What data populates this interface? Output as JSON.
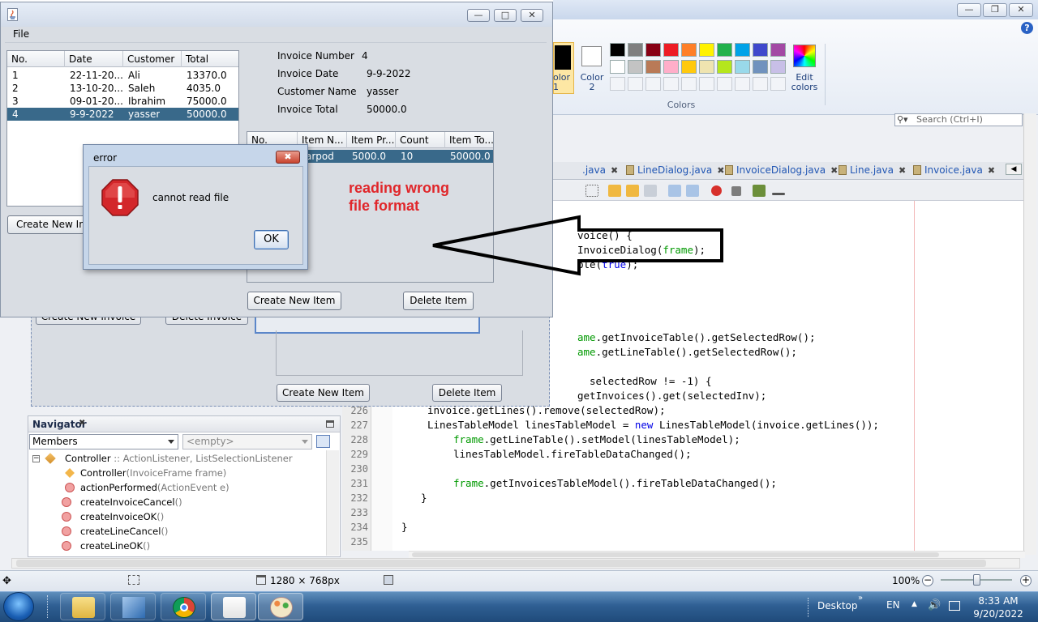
{
  "app": {
    "file_menu": "File",
    "invoices": {
      "columns": [
        "No.",
        "Date",
        "Customer",
        "Total"
      ],
      "rows": [
        {
          "no": "1",
          "date": "22-11-20...",
          "customer": "Ali",
          "total": "13370.0"
        },
        {
          "no": "2",
          "date": "13-10-20...",
          "customer": "Saleh",
          "total": "4035.0"
        },
        {
          "no": "3",
          "date": "09-01-20...",
          "customer": "Ibrahim",
          "total": "75000.0"
        },
        {
          "no": "4",
          "date": "9-9-2022",
          "customer": "yasser",
          "total": "50000.0"
        }
      ],
      "selected_row": "4"
    },
    "details": {
      "invoice_number_label": "Invoice Number",
      "invoice_number": "4",
      "invoice_date_label": "Invoice Date",
      "invoice_date": "9-9-2022",
      "customer_name_label": "Customer Name",
      "customer_name": "yasser",
      "invoice_total_label": "Invoice Total",
      "invoice_total": "50000.0"
    },
    "lines": {
      "columns": [
        "No.",
        "Item N...",
        "Item Pr...",
        "Count",
        "Item To..."
      ],
      "rows": [
        {
          "no": "1",
          "item": "Earpod",
          "price": "5000.0",
          "count": "10",
          "total": "50000.0"
        }
      ],
      "visible_item_fragment": "arpod"
    },
    "buttons": {
      "create_invoice": "Create New Invoice",
      "create_invoice_visible": "Create New Inv",
      "create_item": "Create New Item",
      "delete_item": "Delete Item"
    },
    "annotation_line1": "reading wrong",
    "annotation_line2": "file format"
  },
  "error_dialog": {
    "title": "error",
    "message": "cannot read file",
    "ok_label": "OK"
  },
  "paint": {
    "color1_label": "olor\n1",
    "color2_label": "Color\n2",
    "edit_colors_label": "Edit\ncolors",
    "colors_group_label": "Colors",
    "palette": [
      "#000000",
      "#7f7f7f",
      "#880015",
      "#ed1c24",
      "#ff7f27",
      "#fff200",
      "#22b14c",
      "#00a2e8",
      "#3f48cc",
      "#a349a4",
      "#ffffff",
      "#c3c3c3",
      "#b97a57",
      "#ffaec9",
      "#ffc90e",
      "#efe4b0",
      "#b5e61d",
      "#99d9ea",
      "#7092be",
      "#c8bfe7"
    ],
    "status_size": "1280 × 768px",
    "zoom": "100%"
  },
  "ide": {
    "search_placeholder": "Search (Ctrl+I)",
    "tabs": [
      ".java",
      "LineDialog.java",
      "InvoiceDialog.java",
      "Line.java",
      "Invoice.java"
    ],
    "code": {
      "frag_1": "voice() {",
      "frag_2a": "InvoiceDialog(",
      "frag_2b": "frame",
      "frag_2c": ");",
      "frag_3a": "ble(",
      "frag_3b": "true",
      "frag_3c": ");",
      "frag_4a": "ame",
      "frag_4b": ".getInvoiceTable().getSelectedRow();",
      "frag_5a": "ame",
      "frag_5b": ".getLineTable().getSelectedRow();",
      "frag_6": "selectedRow != -1) {",
      "frag_7": "getInvoices().get(selectedInv);",
      "line_226": "invoice.getLines().remove(selectedRow);",
      "line_227a": "LinesTableModel linesTableModel = ",
      "line_227b": "new",
      "line_227c": " LinesTableModel(invoice.getLines());",
      "line_228a": "frame",
      "line_228b": ".getLineTable().setModel(linesTableModel);",
      "line_229": "linesTableModel.fireTableDataChanged();",
      "line_231a": "frame",
      "line_231b": ".getInvoicesTableModel().fireTableDataChanged();",
      "line_232": "}",
      "line_234": "}"
    },
    "line_numbers": [
      "226",
      "227",
      "228",
      "229",
      "230",
      "231",
      "232",
      "233",
      "234",
      "235"
    ],
    "bg_buttons": {
      "create_invoice": "Create New Invoice",
      "delete_invoice": "Delete Invoice",
      "create_item": "Create New Item",
      "delete_item": "Delete Item"
    },
    "navigator": {
      "title": "Navigator",
      "members": "Members",
      "empty": "<empty>",
      "root_name": "Controller",
      "root_sep": " :: ",
      "root_types": "ActionListener, ListSelectionListener",
      "items": [
        {
          "name": "Controller",
          "params": "(InvoiceFrame frame)"
        },
        {
          "name": "actionPerformed",
          "params": "(ActionEvent e)"
        },
        {
          "name": "createInvoiceCancel",
          "params": "()"
        },
        {
          "name": "createInvoiceOK",
          "params": "()"
        },
        {
          "name": "createLineCancel",
          "params": "()"
        },
        {
          "name": "createLineOK",
          "params": "()"
        }
      ]
    }
  },
  "taskbar": {
    "desktop_label": "Desktop",
    "language": "EN",
    "time": "8:33 AM",
    "date": "9/20/2022"
  },
  "colors": {
    "selection": "#39698a",
    "annotation": "#e0262a",
    "keyword": "#0000e6",
    "field": "#009900"
  }
}
